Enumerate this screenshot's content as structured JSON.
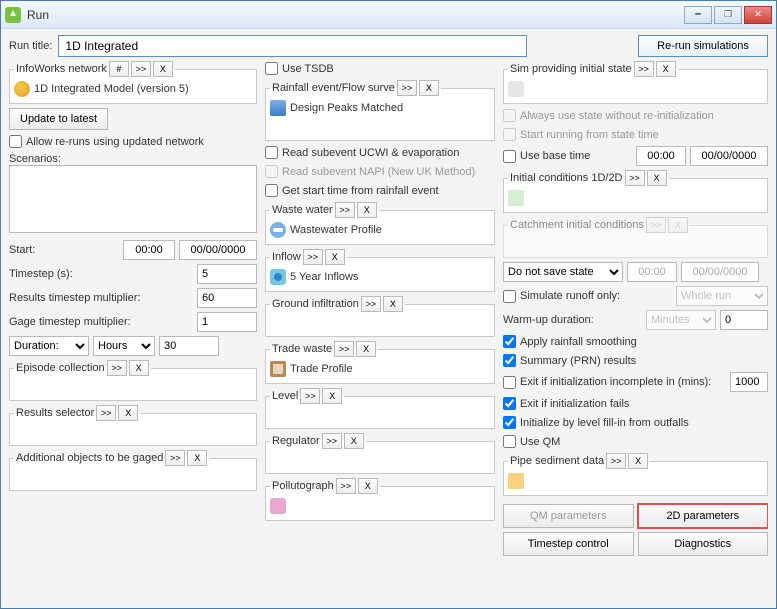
{
  "window": {
    "title": "Run"
  },
  "run_title": {
    "label": "Run title:",
    "value": "1D Integrated"
  },
  "rerun_label": "Re-run simulations",
  "left": {
    "network_group": "InfoWorks network",
    "network_name": "1D Integrated Model (version 5)",
    "update_btn": "Update to latest",
    "allow_rerun": "Allow re-runs using updated network",
    "scenarios_label": "Scenarios:",
    "start_label": "Start:",
    "start_time": "00:00",
    "start_date": "00/00/0000",
    "timestep_label": "Timestep (s):",
    "timestep_value": "5",
    "results_mult_label": "Results timestep multiplier:",
    "results_mult_value": "60",
    "gauge_mult_label": "Gage timestep multiplier:",
    "gauge_mult_value": "1",
    "duration_label": "Duration:",
    "duration_unit": "Hours",
    "duration_value": "30",
    "episode_group": "Episode collection",
    "results_selector_group": "Results selector",
    "addl_objects_group": "Additional objects to be gaged"
  },
  "mid": {
    "use_tsdb": "Use TSDB",
    "rainfall_group": "Rainfall event/Flow surve",
    "rainfall_name": "Design Peaks Matched",
    "read_ucwi": "Read subevent UCWI & evaporation",
    "read_napi": "Read subevent NAPI (New UK Method)",
    "get_start": "Get start time from rainfall event",
    "waste_group": "Waste water",
    "waste_name": "Wastewater Profile",
    "inflow_group": "Inflow",
    "inflow_name": "5 Year Inflows",
    "ground_group": "Ground infiltration",
    "trade_group": "Trade waste",
    "trade_name": "Trade Profile",
    "level_group": "Level",
    "regulator_group": "Regulator",
    "pollutograph_group": "Pollutograph"
  },
  "right": {
    "sim_group": "Sim providing initial state",
    "always_state": "Always use state without re-initialization",
    "start_from_state": "Start running from state time",
    "use_base_time": "Use base time",
    "base_time": "00:00",
    "base_date": "00/00/0000",
    "initcond_group": "Initial conditions 1D/2D",
    "catch_group": "Catchment initial conditions",
    "save_state": "Do not save state",
    "save_time": "00:00",
    "save_date": "00/00/0000",
    "sim_runoff": "Simulate runoff only:",
    "sim_runoff_opt": "Whole run",
    "warmup_label": "Warm-up duration:",
    "warmup_unit": "Minutes",
    "warmup_value": "0",
    "apply_smooth": "Apply rainfall smoothing",
    "summary_prn": "Summary (PRN) results",
    "exit_incomplete": "Exit if initialization incomplete in (mins):",
    "exit_incomplete_val": "1000",
    "exit_fails": "Exit if initialization fails",
    "init_level": "Initialize by level fill-in from outfalls",
    "use_qm": "Use QM",
    "pipe_sed_group": "Pipe sediment data",
    "qm_params": "QM parameters",
    "two_d_params": "2D parameters",
    "timestep_ctrl": "Timestep control",
    "diagnostics": "Diagnostics"
  },
  "btns": {
    "hash": "#",
    "more": ">>",
    "x": "X"
  }
}
